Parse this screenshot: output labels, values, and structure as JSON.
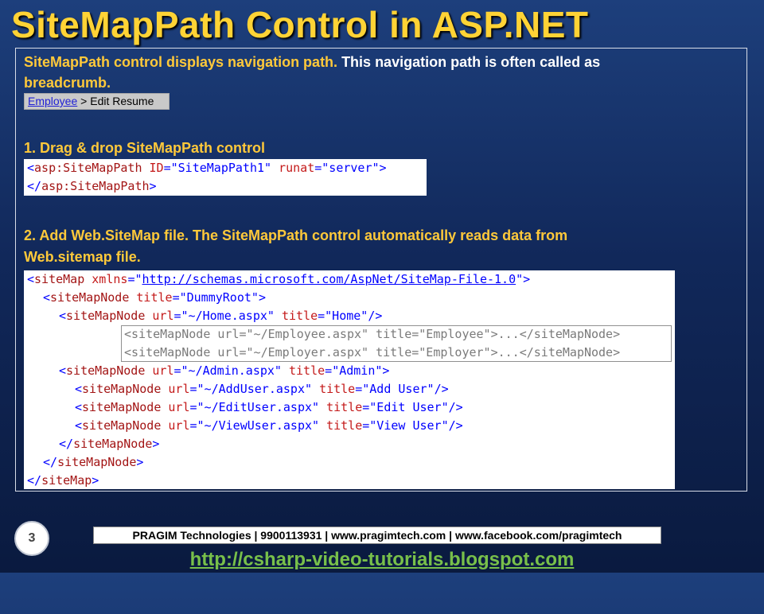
{
  "slide": {
    "title": "SiteMapPath Control in ASP.NET",
    "number": "3"
  },
  "intro": {
    "highlight": "SiteMapPath control displays navigation path.",
    "rest": " This navigation path is often called as",
    "line2": "breadcrumb."
  },
  "breadcrumb_demo": {
    "link": "Employee",
    "separator": " > ",
    "current": "Edit Resume"
  },
  "step1": {
    "heading": "1. Drag & drop SiteMapPath control",
    "code": {
      "l1_open": "<",
      "l1_tag": "asp:SiteMapPath",
      "l1_attr1": "ID",
      "l1_eq1": "=",
      "l1_val1": "\"SiteMapPath1\"",
      "l1_attr2": "runat",
      "l1_eq2": "=",
      "l1_val2": "\"server\"",
      "l1_close": ">",
      "l2_open": "</",
      "l2_tag": "asp:SiteMapPath",
      "l2_close": ">"
    }
  },
  "step2": {
    "heading_line1": "2. Add Web.SiteMap file. The SiteMapPath control automatically reads data from",
    "heading_line2": "Web.sitemap file.",
    "code": {
      "l1": {
        "open": "<",
        "tag": "siteMap",
        "attr": "xmlns",
        "eq": "=\"",
        "url": "http://schemas.microsoft.com/AspNet/SiteMap-File-1.0",
        "end": "\"",
        "close": ">"
      },
      "l2": {
        "open": "<",
        "tag": "siteMapNode",
        "attr": "title",
        "eq": "=",
        "val": "\"DummyRoot\"",
        "close": ">"
      },
      "l3": {
        "open": "<",
        "tag": "siteMapNode",
        "a1": "url",
        "e1": "=",
        "v1": "\"~/Home.aspx\"",
        "a2": "title",
        "e2": "=",
        "v2": "\"Home\"",
        "close": "/>"
      },
      "l4": "<siteMapNode url=\"~/Employee.aspx\" title=\"Employee\">...</siteMapNode>",
      "l5": "<siteMapNode url=\"~/Employer.aspx\" title=\"Employer\">...</siteMapNode>",
      "l6": {
        "open": "<",
        "tag": "siteMapNode",
        "a1": "url",
        "e1": "=",
        "v1": "\"~/Admin.aspx\"",
        "a2": "title",
        "e2": "=",
        "v2": "\"Admin\"",
        "close": ">"
      },
      "l7": {
        "open": "<",
        "tag": "siteMapNode",
        "a1": "url",
        "e1": "=",
        "v1": "\"~/AddUser.aspx\"",
        "a2": "title",
        "e2": "=",
        "v2": "\"Add User\"",
        "close": "/>"
      },
      "l8": {
        "open": "<",
        "tag": "siteMapNode",
        "a1": "url",
        "e1": "=",
        "v1": "\"~/EditUser.aspx\"",
        "a2": "title",
        "e2": "=",
        "v2": "\"Edit User\"",
        "close": "/>"
      },
      "l9": {
        "open": "<",
        "tag": "siteMapNode",
        "a1": "url",
        "e1": "=",
        "v1": "\"~/ViewUser.aspx\"",
        "a2": "title",
        "e2": "=",
        "v2": "\"View User\"",
        "close": "/>"
      },
      "l10": {
        "open": "</",
        "tag": "siteMapNode",
        "close": ">"
      },
      "l11": {
        "open": "</",
        "tag": "siteMapNode",
        "close": ">"
      },
      "l12": {
        "open": "</",
        "tag": "siteMap",
        "close": ">"
      }
    }
  },
  "footer": {
    "contact": "PRAGIM Technologies | 9900113931 | www.pragimtech.com | www.facebook.com/pragimtech",
    "link": "http://csharp-video-tutorials.blogspot.com"
  }
}
